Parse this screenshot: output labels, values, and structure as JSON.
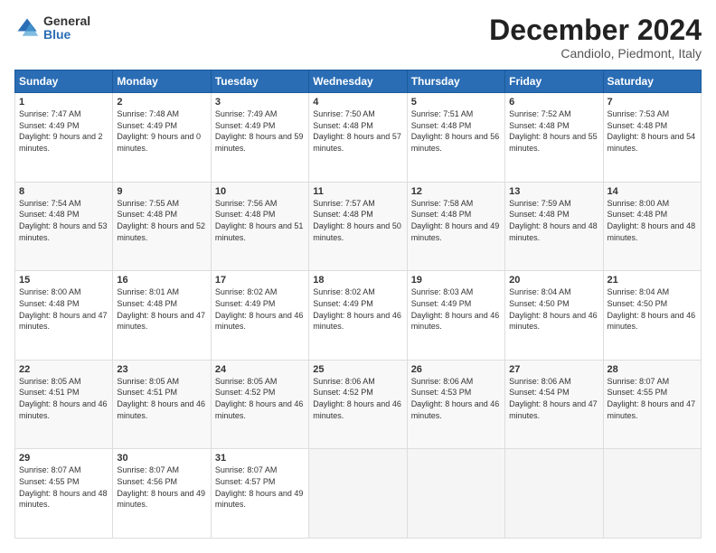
{
  "logo": {
    "general": "General",
    "blue": "Blue"
  },
  "header": {
    "title": "December 2024",
    "subtitle": "Candiolo, Piedmont, Italy"
  },
  "weekdays": [
    "Sunday",
    "Monday",
    "Tuesday",
    "Wednesday",
    "Thursday",
    "Friday",
    "Saturday"
  ],
  "weeks": [
    [
      {
        "day": "1",
        "sunrise": "7:47 AM",
        "sunset": "4:49 PM",
        "daylight": "9 hours and 2 minutes."
      },
      {
        "day": "2",
        "sunrise": "7:48 AM",
        "sunset": "4:49 PM",
        "daylight": "9 hours and 0 minutes."
      },
      {
        "day": "3",
        "sunrise": "7:49 AM",
        "sunset": "4:49 PM",
        "daylight": "8 hours and 59 minutes."
      },
      {
        "day": "4",
        "sunrise": "7:50 AM",
        "sunset": "4:48 PM",
        "daylight": "8 hours and 57 minutes."
      },
      {
        "day": "5",
        "sunrise": "7:51 AM",
        "sunset": "4:48 PM",
        "daylight": "8 hours and 56 minutes."
      },
      {
        "day": "6",
        "sunrise": "7:52 AM",
        "sunset": "4:48 PM",
        "daylight": "8 hours and 55 minutes."
      },
      {
        "day": "7",
        "sunrise": "7:53 AM",
        "sunset": "4:48 PM",
        "daylight": "8 hours and 54 minutes."
      }
    ],
    [
      {
        "day": "8",
        "sunrise": "7:54 AM",
        "sunset": "4:48 PM",
        "daylight": "8 hours and 53 minutes."
      },
      {
        "day": "9",
        "sunrise": "7:55 AM",
        "sunset": "4:48 PM",
        "daylight": "8 hours and 52 minutes."
      },
      {
        "day": "10",
        "sunrise": "7:56 AM",
        "sunset": "4:48 PM",
        "daylight": "8 hours and 51 minutes."
      },
      {
        "day": "11",
        "sunrise": "7:57 AM",
        "sunset": "4:48 PM",
        "daylight": "8 hours and 50 minutes."
      },
      {
        "day": "12",
        "sunrise": "7:58 AM",
        "sunset": "4:48 PM",
        "daylight": "8 hours and 49 minutes."
      },
      {
        "day": "13",
        "sunrise": "7:59 AM",
        "sunset": "4:48 PM",
        "daylight": "8 hours and 48 minutes."
      },
      {
        "day": "14",
        "sunrise": "8:00 AM",
        "sunset": "4:48 PM",
        "daylight": "8 hours and 48 minutes."
      }
    ],
    [
      {
        "day": "15",
        "sunrise": "8:00 AM",
        "sunset": "4:48 PM",
        "daylight": "8 hours and 47 minutes."
      },
      {
        "day": "16",
        "sunrise": "8:01 AM",
        "sunset": "4:48 PM",
        "daylight": "8 hours and 47 minutes."
      },
      {
        "day": "17",
        "sunrise": "8:02 AM",
        "sunset": "4:49 PM",
        "daylight": "8 hours and 46 minutes."
      },
      {
        "day": "18",
        "sunrise": "8:02 AM",
        "sunset": "4:49 PM",
        "daylight": "8 hours and 46 minutes."
      },
      {
        "day": "19",
        "sunrise": "8:03 AM",
        "sunset": "4:49 PM",
        "daylight": "8 hours and 46 minutes."
      },
      {
        "day": "20",
        "sunrise": "8:04 AM",
        "sunset": "4:50 PM",
        "daylight": "8 hours and 46 minutes."
      },
      {
        "day": "21",
        "sunrise": "8:04 AM",
        "sunset": "4:50 PM",
        "daylight": "8 hours and 46 minutes."
      }
    ],
    [
      {
        "day": "22",
        "sunrise": "8:05 AM",
        "sunset": "4:51 PM",
        "daylight": "8 hours and 46 minutes."
      },
      {
        "day": "23",
        "sunrise": "8:05 AM",
        "sunset": "4:51 PM",
        "daylight": "8 hours and 46 minutes."
      },
      {
        "day": "24",
        "sunrise": "8:05 AM",
        "sunset": "4:52 PM",
        "daylight": "8 hours and 46 minutes."
      },
      {
        "day": "25",
        "sunrise": "8:06 AM",
        "sunset": "4:52 PM",
        "daylight": "8 hours and 46 minutes."
      },
      {
        "day": "26",
        "sunrise": "8:06 AM",
        "sunset": "4:53 PM",
        "daylight": "8 hours and 46 minutes."
      },
      {
        "day": "27",
        "sunrise": "8:06 AM",
        "sunset": "4:54 PM",
        "daylight": "8 hours and 47 minutes."
      },
      {
        "day": "28",
        "sunrise": "8:07 AM",
        "sunset": "4:55 PM",
        "daylight": "8 hours and 47 minutes."
      }
    ],
    [
      {
        "day": "29",
        "sunrise": "8:07 AM",
        "sunset": "4:55 PM",
        "daylight": "8 hours and 48 minutes."
      },
      {
        "day": "30",
        "sunrise": "8:07 AM",
        "sunset": "4:56 PM",
        "daylight": "8 hours and 49 minutes."
      },
      {
        "day": "31",
        "sunrise": "8:07 AM",
        "sunset": "4:57 PM",
        "daylight": "8 hours and 49 minutes."
      },
      null,
      null,
      null,
      null
    ]
  ]
}
